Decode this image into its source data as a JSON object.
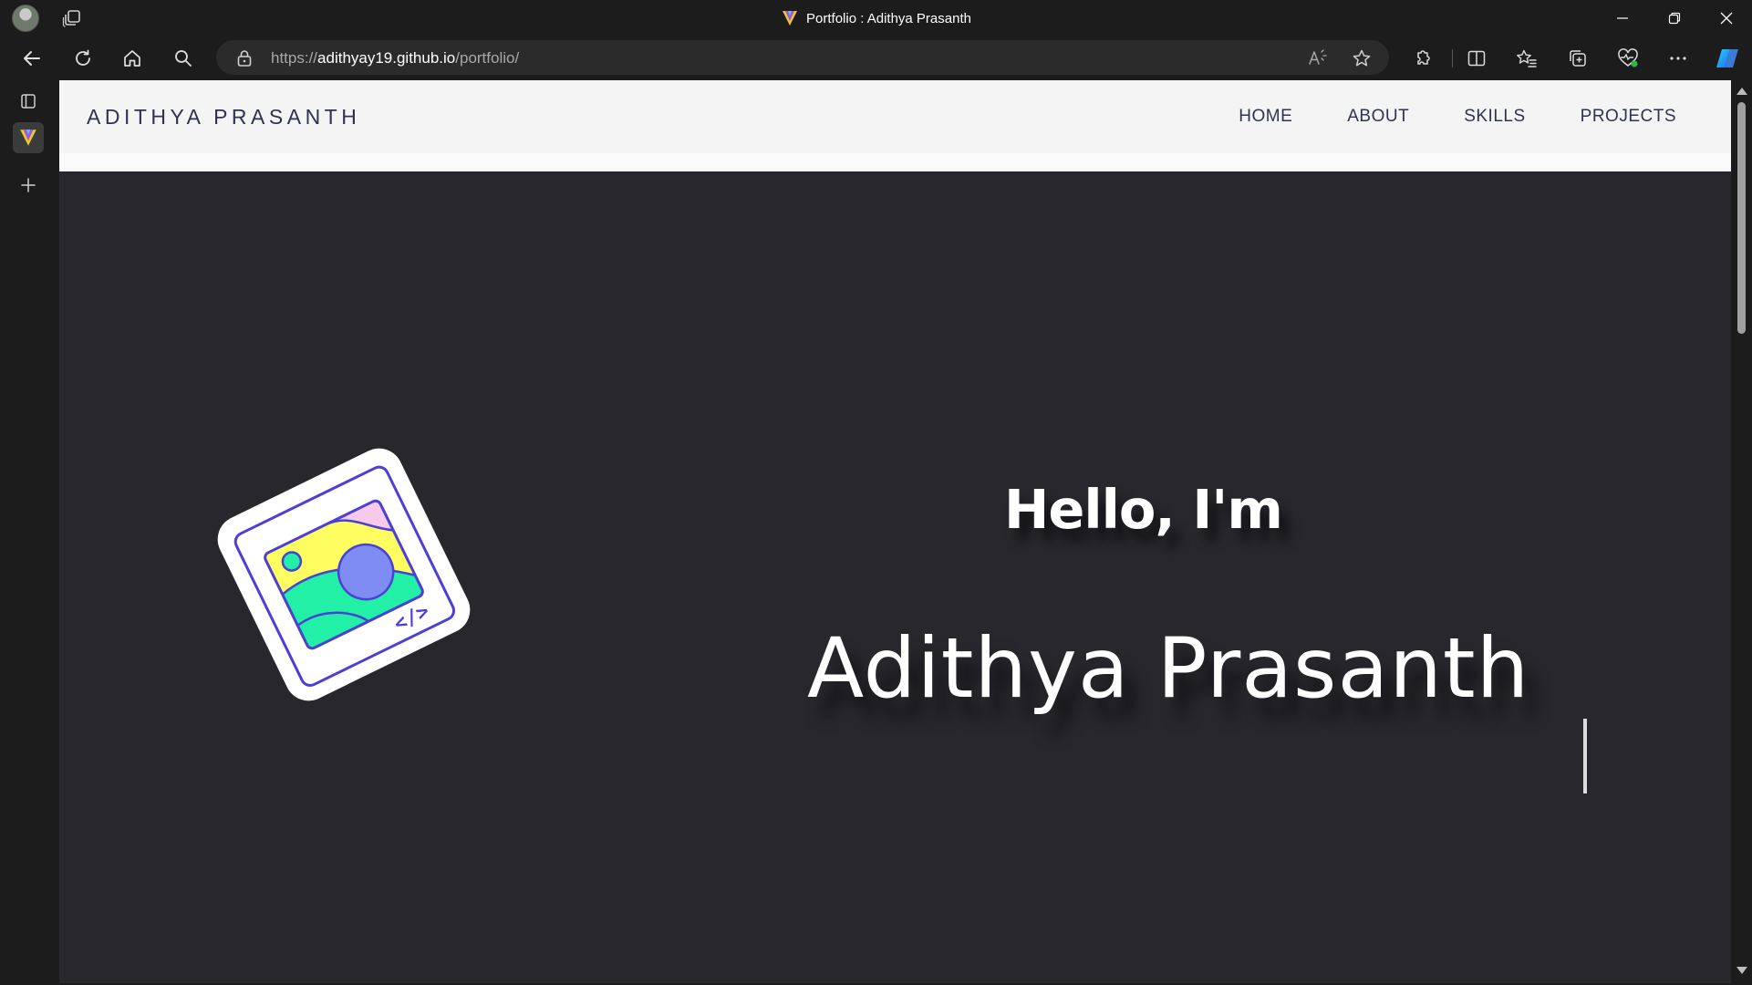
{
  "browser": {
    "window_title": "Portfolio : Adithya Prasanth",
    "url_scheme": "https://",
    "url_host": "adithyay19.github.io",
    "url_path": "/portfolio/"
  },
  "site": {
    "brand": "ADITHYA PRASANTH",
    "nav": [
      {
        "label": "HOME"
      },
      {
        "label": "ABOUT"
      },
      {
        "label": "SKILLS"
      },
      {
        "label": "PROJECTS"
      }
    ],
    "hero": {
      "greeting": "Hello, I'm",
      "name": "Adithya Prasanth",
      "illustration_badge": "</>"
    }
  },
  "colors": {
    "frame": "#1c1c1c",
    "page_background": "#27272d",
    "header_background": "#f4f4f5",
    "header_text": "#2f3350",
    "hero_text": "#ffffff",
    "illustration_outline": "#4b3fd6",
    "illustration_yellow": "#fdfd60",
    "illustration_green": "#22f0a6",
    "illustration_pink": "#f7c9ea",
    "illustration_blue": "#7f8cf3"
  },
  "icons": {
    "titlebar": [
      "profile-avatar",
      "tab-actions-icon",
      "minimize-icon",
      "restore-icon",
      "close-icon"
    ],
    "navigation": [
      "back-icon",
      "refresh-icon",
      "home-icon",
      "search-icon",
      "lock-icon"
    ],
    "address_bar": [
      "read-aloud-icon",
      "favorite-star-icon"
    ],
    "toolbar": [
      "extensions-icon",
      "split-screen-icon",
      "favorites-icon",
      "collections-icon",
      "browser-essentials-icon",
      "more-icon",
      "copilot-icon"
    ],
    "sidebar": [
      "tab-list-icon",
      "active-tab-favicon",
      "new-tab-plus-icon"
    ]
  }
}
